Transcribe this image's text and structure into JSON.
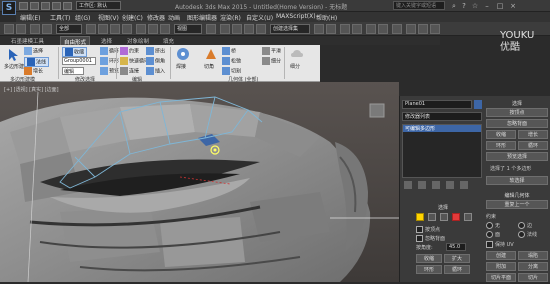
{
  "title_bar": {
    "logo": "3ds-max-logo",
    "workspace_dropdown": "工作区: 默认",
    "title": "Autodesk 3ds Max 2015 - Untitled(Home Version) - 无标题",
    "search_placeholder": "键入关键字或短语"
  },
  "menu": {
    "items": [
      "编辑(E)",
      "工具(T)",
      "组(G)",
      "视图(V)",
      "创建(C)",
      "修改器",
      "动画",
      "图形编辑器",
      "渲染(R)",
      "自定义(U)",
      "MAXScript(X)",
      "帮助(H)"
    ]
  },
  "toolbar": {
    "filter_dropdown": "全部",
    "view_dropdown": "视图",
    "selection_set_dropdown": "创建选择集"
  },
  "ribbon_tabs": [
    "石墨建模工具",
    "自由形式",
    "选择",
    "对象绘制",
    "填充"
  ],
  "ribbon": {
    "groups": {
      "polygon_modeling": "多边形建模",
      "modify_selection": "修改选择",
      "edit": "编辑",
      "geometry_all": "几何体 (全部)",
      "subdivision": "细分",
      "align": "对齐",
      "properties": "属性"
    },
    "items": {
      "edit_polygon": "多边形建模",
      "select": "选择",
      "normal": "法线",
      "grow": "增长",
      "shrink": "收缩",
      "loop": "循环",
      "ring": "环形",
      "preview": "预览",
      "constrain": "约束",
      "swift_loop": "快速循环",
      "connect": "连接",
      "extrude": "挤出",
      "bevel": "倒角",
      "inset": "插入",
      "weld": "焊接",
      "chamfer": "切角",
      "bridge": "桥",
      "relax": "松弛",
      "cut": "切割",
      "smooth": "平滑",
      "group_field": "Group0001",
      "sub_field": "编辑",
      "tessellate": "细分"
    }
  },
  "viewport": {
    "label": "[+] [透视] [真实] [边面]"
  },
  "command_panel": {
    "object_name": "Plane01",
    "modifier_list": "修改器列表",
    "stack": [
      "可编辑多边形"
    ],
    "selection_header": "选择",
    "soft_selection_header": "软选择",
    "edit_geometry_header": "编辑几何体",
    "repeat_last": "重复上一个",
    "buttons": {
      "by_vertex": "按顶点",
      "ignore_back": "忽略背面",
      "shrink": "收缩",
      "grow": "增长",
      "ring": "环形",
      "loop": "循环",
      "preview_sel": "预览选择",
      "create": "创建",
      "collapse": "塌陷",
      "attach": "附加",
      "detach": "分离",
      "slice_plane": "切片平面",
      "slice": "切片",
      "quick_slice": "快速切片",
      "cut": "切割",
      "msmooth": "网格平滑",
      "tessellate": "细化"
    },
    "constraint_label": "约束",
    "constraints": [
      "无",
      "边",
      "面",
      "法线"
    ],
    "preserve_uv": "保持 UV",
    "selected_count": "选择了 1 个多边形"
  },
  "selection_sub": {
    "header": "选择",
    "by_vertex": "按顶点",
    "ignore_backface": "忽略背面",
    "by_angle_label": "按角度:",
    "by_angle_value": "45.0",
    "shrink": "收缩",
    "grow": "扩大",
    "ring": "环形",
    "loop": "循环"
  },
  "watermark": "YOUKU\n优酷",
  "colors": {
    "ribbon_bg": "#e6e6e6",
    "viewport_bg": "#4b4745",
    "cage": "#7fb6d6",
    "selection": "#3d66a6",
    "vertex_highlight": "#ffff66"
  }
}
